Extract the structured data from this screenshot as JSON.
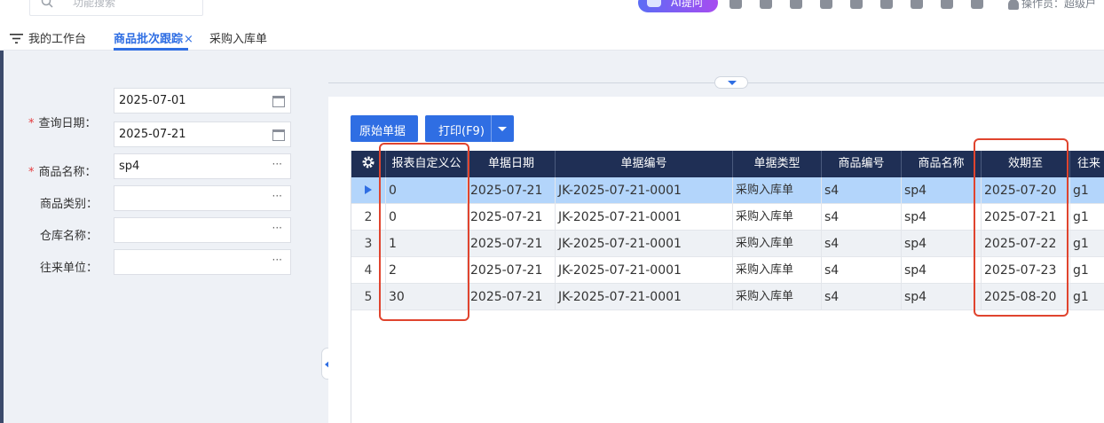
{
  "header": {
    "search_placeholder": "功能搜索",
    "ai_button": "AI提问",
    "operator": "操作员：超级户"
  },
  "tabs": [
    {
      "label": "我的工作台"
    },
    {
      "label": "商品批次跟踪",
      "close": "×"
    },
    {
      "label": "采购入库单"
    }
  ],
  "filters": {
    "date_label": "查询日期：",
    "date_from": "2025-07-01",
    "date_to": "2025-07-21",
    "product_label": "商品名称：",
    "product_value": "sp4",
    "category_label": "商品类别：",
    "warehouse_label": "仓库名称：",
    "partner_label": "往来单位：",
    "required_mark": "*",
    "more": "···"
  },
  "toolbar": {
    "original_doc": "原始单据",
    "print": "打印(F9)"
  },
  "grid": {
    "columns": [
      "报表自定义公",
      "单据日期",
      "单据编号",
      "单据类型",
      "商品编号",
      "商品名称",
      "效期至",
      "往来"
    ],
    "rows": [
      {
        "idx": "",
        "custom": "0",
        "date": "2025-07-21",
        "no": "JK-2025-07-21-0001",
        "type": "采购入库单",
        "code": "s4",
        "name": "sp4",
        "expire": "2025-07-20",
        "partner": "g1"
      },
      {
        "idx": "2",
        "custom": "0",
        "date": "2025-07-21",
        "no": "JK-2025-07-21-0001",
        "type": "采购入库单",
        "code": "s4",
        "name": "sp4",
        "expire": "2025-07-21",
        "partner": "g1"
      },
      {
        "idx": "3",
        "custom": "1",
        "date": "2025-07-21",
        "no": "JK-2025-07-21-0001",
        "type": "采购入库单",
        "code": "s4",
        "name": "sp4",
        "expire": "2025-07-22",
        "partner": "g1"
      },
      {
        "idx": "4",
        "custom": "2",
        "date": "2025-07-21",
        "no": "JK-2025-07-21-0001",
        "type": "采购入库单",
        "code": "s4",
        "name": "sp4",
        "expire": "2025-07-23",
        "partner": "g1"
      },
      {
        "idx": "5",
        "custom": "30",
        "date": "2025-07-21",
        "no": "JK-2025-07-21-0001",
        "type": "采购入库单",
        "code": "s4",
        "name": "sp4",
        "expire": "2025-08-20",
        "partner": "g1"
      }
    ]
  },
  "colors": {
    "accent": "#2f6ee3",
    "header_bg": "#1f2f55",
    "selected_row": "#b3d5fb",
    "highlight": "#e0442e"
  }
}
